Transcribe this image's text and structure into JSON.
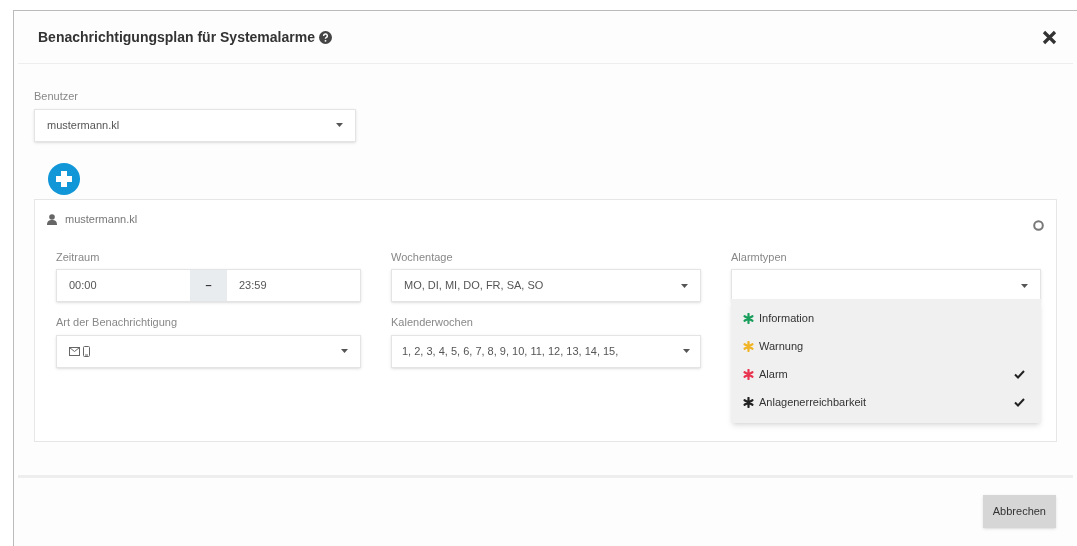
{
  "dialog": {
    "title": "Benachrichtigungsplan für Systemalarme"
  },
  "user_select": {
    "label": "Benutzer",
    "value": "mustermann.kl"
  },
  "plan": {
    "user": "mustermann.kl",
    "period": {
      "label": "Zeitraum",
      "from": "00:00",
      "separator": "–",
      "to": "23:59"
    },
    "weekdays": {
      "label": "Wochentage",
      "value": "MO, DI, MI, DO, FR, SA, SO"
    },
    "alarm_types": {
      "label": "Alarmtypen",
      "options": [
        {
          "label": "Information",
          "color": "#1a9e5c",
          "checked": false
        },
        {
          "label": "Warnung",
          "color": "#f0b323",
          "checked": false
        },
        {
          "label": "Alarm",
          "color": "#e8344e",
          "checked": true
        },
        {
          "label": "Anlagenerreichbarkeit",
          "color": "#222222",
          "checked": true
        }
      ]
    },
    "notification_type": {
      "label": "Art der Benachrichtigung",
      "email": true,
      "sms": true
    },
    "calendar_weeks": {
      "label": "Kalenderwochen",
      "value": "1, 2, 3, 4, 5, 6, 7, 8, 9, 10, 11, 12, 13, 14, 15,"
    }
  },
  "buttons": [
    {
      "label": "Abbrechen"
    }
  ]
}
